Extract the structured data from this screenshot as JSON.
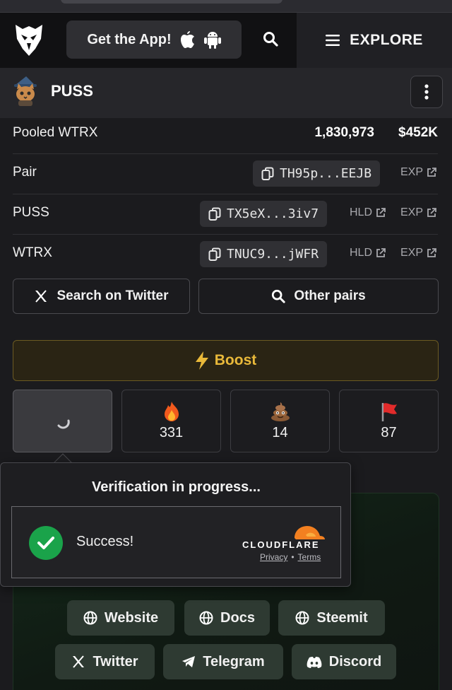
{
  "header": {
    "get_app_label": "Get the App!",
    "explore_label": "EXPLORE"
  },
  "token": {
    "name": "PUSS"
  },
  "pooled": {
    "label": "Pooled WTRX",
    "amount": "1,830,973",
    "usd": "$452K"
  },
  "pairs": [
    {
      "label": "Pair",
      "address": "TH95p...EEJB",
      "links": [
        "EXP"
      ]
    },
    {
      "label": "PUSS",
      "address": "TX5eX...3iv7",
      "links": [
        "HLD",
        "EXP"
      ]
    },
    {
      "label": "WTRX",
      "address": "TNUC9...jWFR",
      "links": [
        "HLD",
        "EXP"
      ]
    }
  ],
  "actions": {
    "search_twitter": "Search on Twitter",
    "other_pairs": "Other pairs",
    "boost": "Boost"
  },
  "reactions": [
    {
      "icon": "loading-spinner",
      "count": ""
    },
    {
      "icon": "fire-emoji",
      "count": "331"
    },
    {
      "icon": "poop-emoji",
      "count": "14"
    },
    {
      "icon": "red-flag-emoji",
      "count": "87"
    }
  ],
  "verification": {
    "title": "Verification in progress...",
    "status": "Success!",
    "brand": "CLOUDFLARE",
    "privacy": "Privacy",
    "separator": "•",
    "terms": "Terms"
  },
  "links": {
    "website": "Website",
    "docs": "Docs",
    "steemit": "Steemit",
    "twitter": "Twitter",
    "telegram": "Telegram",
    "discord": "Discord"
  },
  "colors": {
    "background": "#1b1b1e",
    "boost_accent": "#e9b93a",
    "success_green": "#1aa34a",
    "cloudflare_orange": "#f38020"
  }
}
